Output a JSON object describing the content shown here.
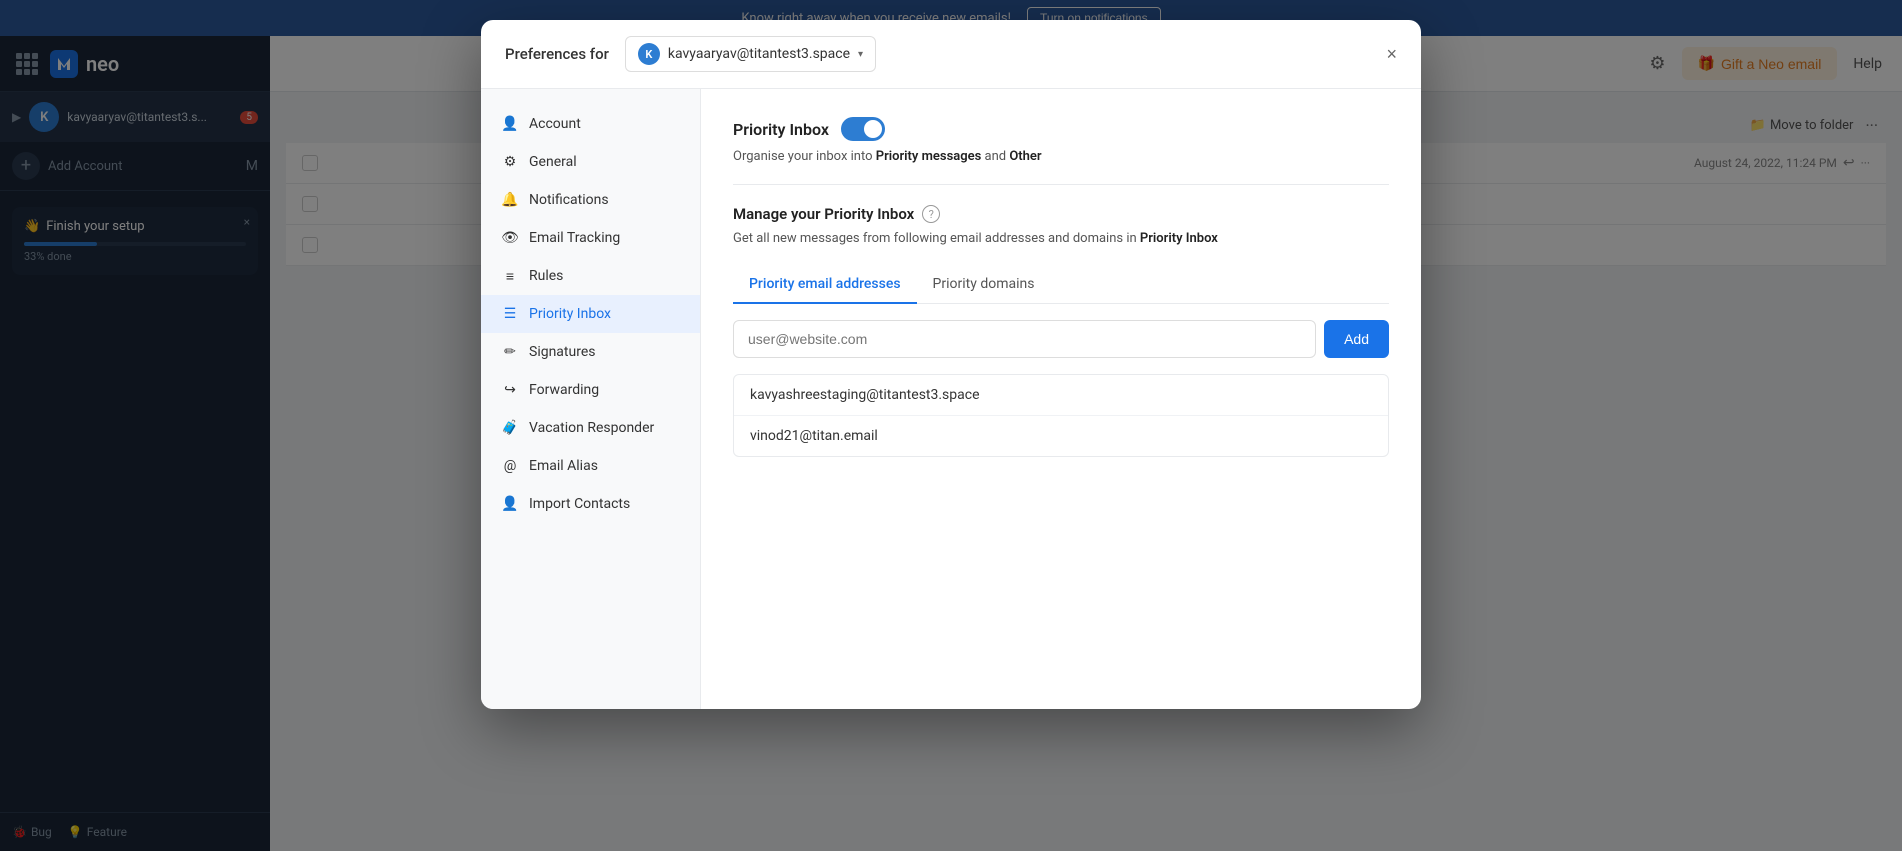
{
  "app": {
    "name": "neo",
    "notification_bar": {
      "text": "Know right away when you receive new emails!",
      "button_label": "Turn on notifications"
    }
  },
  "sidebar": {
    "account": {
      "name": "kavyaaryav@titantest3.s...",
      "badge": "5",
      "avatar_letter": "K"
    },
    "add_account_label": "Add Account",
    "setup": {
      "title": "Finish your setup",
      "emoji": "👋",
      "progress": 33,
      "percent_label": "33% done"
    },
    "footer": {
      "bug_label": "Bug",
      "feature_label": "Feature"
    }
  },
  "header": {
    "gift_label": "Gift a Neo email",
    "help_label": "Help",
    "move_folder_label": "Move to folder"
  },
  "modal": {
    "title": "Preferences for",
    "close_icon": "×",
    "account": {
      "email": "kavyaaryav@titantest3.space",
      "avatar_letter": "K"
    },
    "nav_items": [
      {
        "id": "account",
        "label": "Account",
        "icon": "person"
      },
      {
        "id": "general",
        "label": "General",
        "icon": "gear"
      },
      {
        "id": "notifications",
        "label": "Notifications",
        "icon": "bell"
      },
      {
        "id": "email-tracking",
        "label": "Email Tracking",
        "icon": "eye"
      },
      {
        "id": "rules",
        "label": "Rules",
        "icon": "bars"
      },
      {
        "id": "priority-inbox",
        "label": "Priority Inbox",
        "icon": "list"
      },
      {
        "id": "signatures",
        "label": "Signatures",
        "icon": "pencil"
      },
      {
        "id": "forwarding",
        "label": "Forwarding",
        "icon": "forward"
      },
      {
        "id": "vacation-responder",
        "label": "Vacation Responder",
        "icon": "suitcase"
      },
      {
        "id": "email-alias",
        "label": "Email Alias",
        "icon": "at"
      },
      {
        "id": "import-contacts",
        "label": "Import Contacts",
        "icon": "user-plus"
      }
    ],
    "active_nav": "priority-inbox",
    "content": {
      "section_title": "Priority Inbox",
      "toggle_on": true,
      "section_desc_before": "Organise your inbox into ",
      "section_desc_bold1": "Priority messages",
      "section_desc_middle": " and ",
      "section_desc_bold2": "Other",
      "manage_title": "Manage your Priority Inbox",
      "manage_desc_before": "Get all new messages from following email addresses and domains in ",
      "manage_desc_bold": "Priority Inbox",
      "tabs": [
        {
          "id": "email-addresses",
          "label": "Priority email addresses"
        },
        {
          "id": "domains",
          "label": "Priority domains"
        }
      ],
      "active_tab": "email-addresses",
      "input_placeholder": "user@website.com",
      "add_button_label": "Add",
      "email_list": [
        "kavyashreestaging@titantest3.space",
        "vinod21@titan.email"
      ]
    }
  },
  "email_rows": [
    {
      "date": "August 24, 2022, 11:24 PM"
    }
  ],
  "colors": {
    "brand_blue": "#2d7dd2",
    "active_blue": "#1a73e8",
    "nav_active_bg": "#e8f0fe"
  }
}
